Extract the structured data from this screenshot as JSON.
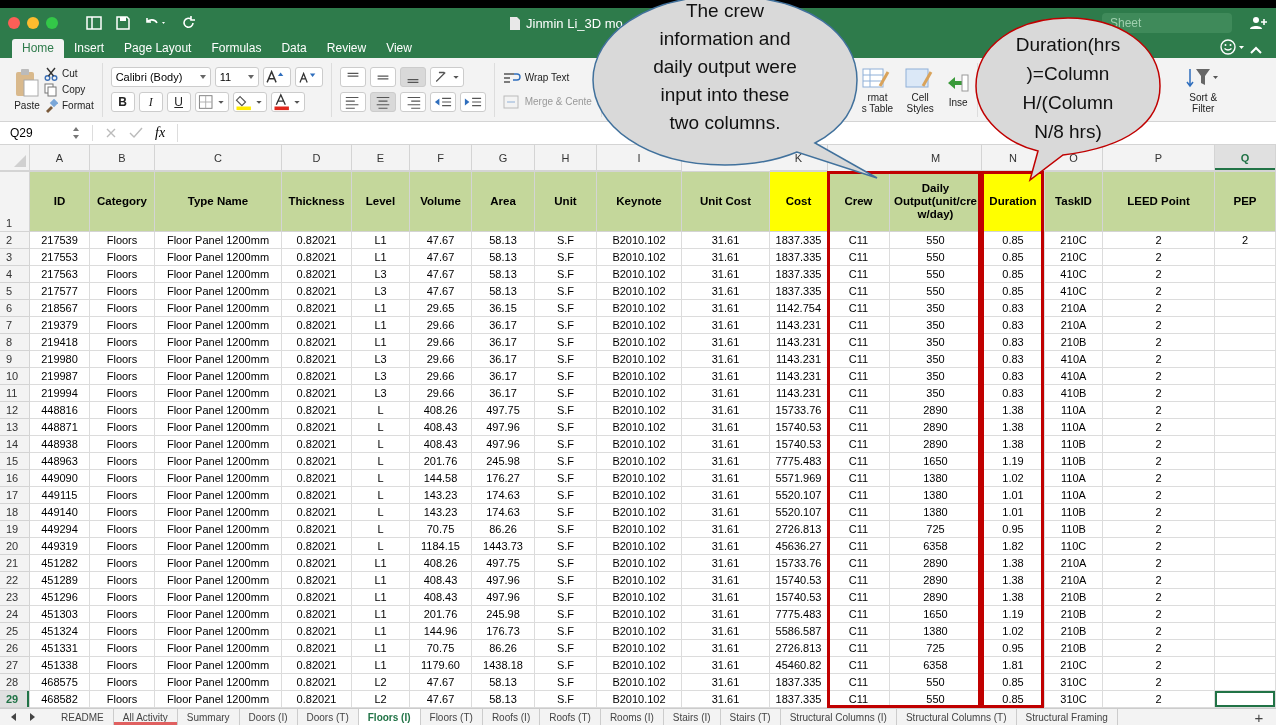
{
  "window": {
    "title": "Jinmin Li_3D mo",
    "search_placeholder": "Sheet"
  },
  "ribbon_tabs": [
    {
      "label": "Home",
      "selected": true
    },
    {
      "label": "Insert",
      "selected": false
    },
    {
      "label": "Page Layout",
      "selected": false
    },
    {
      "label": "Formulas",
      "selected": false
    },
    {
      "label": "Data",
      "selected": false
    },
    {
      "label": "Review",
      "selected": false
    },
    {
      "label": "View",
      "selected": false
    }
  ],
  "ribbon": {
    "paste": "Paste",
    "cut": "Cut",
    "copy": "Copy",
    "format": "Format",
    "font_name": "Calibri (Body)",
    "font_size": "11",
    "bold": "B",
    "italic": "I",
    "underline": "U",
    "wrap_text": "Wrap Text",
    "merge_center": "Merge & Cente",
    "format_table": "rmat\ns Table",
    "cell_styles": "Cell\nStyles",
    "insert": "Inse",
    "sort_filter": "Sort &\nFilter"
  },
  "formula_bar": {
    "name_box": "Q29",
    "fx": "fx"
  },
  "columns": [
    {
      "letter": "A",
      "header": "ID",
      "selected": false,
      "highlight": false,
      "outline_left": false,
      "outline_right": false
    },
    {
      "letter": "B",
      "header": "Category",
      "selected": false,
      "highlight": false,
      "outline_left": false,
      "outline_right": false
    },
    {
      "letter": "C",
      "header": "Type Name",
      "selected": false,
      "highlight": false,
      "outline_left": false,
      "outline_right": false
    },
    {
      "letter": "D",
      "header": "Thickness",
      "selected": false,
      "highlight": false,
      "outline_left": false,
      "outline_right": false
    },
    {
      "letter": "E",
      "header": "Level",
      "selected": false,
      "highlight": false,
      "outline_left": false,
      "outline_right": false
    },
    {
      "letter": "F",
      "header": "Volume",
      "selected": false,
      "highlight": false,
      "outline_left": false,
      "outline_right": false
    },
    {
      "letter": "G",
      "header": "Area",
      "selected": false,
      "highlight": false,
      "outline_left": false,
      "outline_right": false
    },
    {
      "letter": "H",
      "header": "Unit",
      "selected": false,
      "highlight": false,
      "outline_left": false,
      "outline_right": false
    },
    {
      "letter": "I",
      "header": "Keynote",
      "selected": false,
      "highlight": false,
      "outline_left": false,
      "outline_right": false
    },
    {
      "header": "Unit Cost",
      "selected": false,
      "highlight": false,
      "outline_left": false,
      "outline_right": false
    },
    {
      "letter": "K",
      "header": "Cost",
      "selected": false,
      "highlight": true,
      "outline_left": false,
      "outline_right": false
    },
    {
      "header": "Crew",
      "selected": false,
      "highlight": false,
      "outline_left": true,
      "outline_right": false
    },
    {
      "letter": "M",
      "header": "Daily Output(unit/crew/day)",
      "selected": false,
      "highlight": false,
      "outline_left": false,
      "outline_right": true
    },
    {
      "letter": "N",
      "header": "Duration",
      "selected": false,
      "highlight": true,
      "outline_left": true,
      "outline_right": true
    },
    {
      "letter": "O",
      "header": "TaskID",
      "selected": false,
      "highlight": false,
      "outline_left": false,
      "outline_right": false
    },
    {
      "letter": "P",
      "header": "LEED Point",
      "selected": false,
      "highlight": false,
      "outline_left": false,
      "outline_right": false
    },
    {
      "letter": "Q",
      "header": "PEP",
      "selected": true,
      "highlight": false,
      "outline_left": false,
      "outline_right": false
    }
  ],
  "header_row": {
    "number": "1"
  },
  "rows": [
    {
      "number": "2",
      "selected": false,
      "cells": [
        "217539",
        "Floors",
        "Floor Panel 1200mm",
        "0.82021",
        "L1",
        "47.67",
        "58.13",
        "S.F",
        "B2010.102",
        "31.61",
        "1837.335",
        "C11",
        "550",
        "0.85",
        "210C",
        "2",
        "2"
      ]
    },
    {
      "number": "3",
      "selected": false,
      "cells": [
        "217553",
        "Floors",
        "Floor Panel 1200mm",
        "0.82021",
        "L1",
        "47.67",
        "58.13",
        "S.F",
        "B2010.102",
        "31.61",
        "1837.335",
        "C11",
        "550",
        "0.85",
        "210C",
        "2"
      ]
    },
    {
      "number": "4",
      "selected": false,
      "cells": [
        "217563",
        "Floors",
        "Floor Panel 1200mm",
        "0.82021",
        "L3",
        "47.67",
        "58.13",
        "S.F",
        "B2010.102",
        "31.61",
        "1837.335",
        "C11",
        "550",
        "0.85",
        "410C",
        "2"
      ]
    },
    {
      "number": "5",
      "selected": false,
      "cells": [
        "217577",
        "Floors",
        "Floor Panel 1200mm",
        "0.82021",
        "L3",
        "47.67",
        "58.13",
        "S.F",
        "B2010.102",
        "31.61",
        "1837.335",
        "C11",
        "550",
        "0.85",
        "410C",
        "2"
      ]
    },
    {
      "number": "6",
      "selected": false,
      "cells": [
        "218567",
        "Floors",
        "Floor Panel 1200mm",
        "0.82021",
        "L1",
        "29.65",
        "36.15",
        "S.F",
        "B2010.102",
        "31.61",
        "1142.754",
        "C11",
        "350",
        "0.83",
        "210A",
        "2"
      ]
    },
    {
      "number": "7",
      "selected": false,
      "cells": [
        "219379",
        "Floors",
        "Floor Panel 1200mm",
        "0.82021",
        "L1",
        "29.66",
        "36.17",
        "S.F",
        "B2010.102",
        "31.61",
        "1143.231",
        "C11",
        "350",
        "0.83",
        "210A",
        "2"
      ]
    },
    {
      "number": "8",
      "selected": false,
      "cells": [
        "219418",
        "Floors",
        "Floor Panel 1200mm",
        "0.82021",
        "L1",
        "29.66",
        "36.17",
        "S.F",
        "B2010.102",
        "31.61",
        "1143.231",
        "C11",
        "350",
        "0.83",
        "210B",
        "2"
      ]
    },
    {
      "number": "9",
      "selected": false,
      "cells": [
        "219980",
        "Floors",
        "Floor Panel 1200mm",
        "0.82021",
        "L3",
        "29.66",
        "36.17",
        "S.F",
        "B2010.102",
        "31.61",
        "1143.231",
        "C11",
        "350",
        "0.83",
        "410A",
        "2"
      ]
    },
    {
      "number": "10",
      "selected": false,
      "cells": [
        "219987",
        "Floors",
        "Floor Panel 1200mm",
        "0.82021",
        "L3",
        "29.66",
        "36.17",
        "S.F",
        "B2010.102",
        "31.61",
        "1143.231",
        "C11",
        "350",
        "0.83",
        "410A",
        "2"
      ]
    },
    {
      "number": "11",
      "selected": false,
      "cells": [
        "219994",
        "Floors",
        "Floor Panel 1200mm",
        "0.82021",
        "L3",
        "29.66",
        "36.17",
        "S.F",
        "B2010.102",
        "31.61",
        "1143.231",
        "C11",
        "350",
        "0.83",
        "410B",
        "2"
      ]
    },
    {
      "number": "12",
      "selected": false,
      "cells": [
        "448816",
        "Floors",
        "Floor Panel 1200mm",
        "0.82021",
        "L",
        "408.26",
        "497.75",
        "S.F",
        "B2010.102",
        "31.61",
        "15733.76",
        "C11",
        "2890",
        "1.38",
        "110A",
        "2"
      ]
    },
    {
      "number": "13",
      "selected": false,
      "cells": [
        "448871",
        "Floors",
        "Floor Panel 1200mm",
        "0.82021",
        "L",
        "408.43",
        "497.96",
        "S.F",
        "B2010.102",
        "31.61",
        "15740.53",
        "C11",
        "2890",
        "1.38",
        "110A",
        "2"
      ]
    },
    {
      "number": "14",
      "selected": false,
      "cells": [
        "448938",
        "Floors",
        "Floor Panel 1200mm",
        "0.82021",
        "L",
        "408.43",
        "497.96",
        "S.F",
        "B2010.102",
        "31.61",
        "15740.53",
        "C11",
        "2890",
        "1.38",
        "110B",
        "2"
      ]
    },
    {
      "number": "15",
      "selected": false,
      "cells": [
        "448963",
        "Floors",
        "Floor Panel 1200mm",
        "0.82021",
        "L",
        "201.76",
        "245.98",
        "S.F",
        "B2010.102",
        "31.61",
        "7775.483",
        "C11",
        "1650",
        "1.19",
        "110B",
        "2"
      ]
    },
    {
      "number": "16",
      "selected": false,
      "cells": [
        "449090",
        "Floors",
        "Floor Panel 1200mm",
        "0.82021",
        "L",
        "144.58",
        "176.27",
        "S.F",
        "B2010.102",
        "31.61",
        "5571.969",
        "C11",
        "1380",
        "1.02",
        "110A",
        "2"
      ]
    },
    {
      "number": "17",
      "selected": false,
      "cells": [
        "449115",
        "Floors",
        "Floor Panel 1200mm",
        "0.82021",
        "L",
        "143.23",
        "174.63",
        "S.F",
        "B2010.102",
        "31.61",
        "5520.107",
        "C11",
        "1380",
        "1.01",
        "110A",
        "2"
      ]
    },
    {
      "number": "18",
      "selected": false,
      "cells": [
        "449140",
        "Floors",
        "Floor Panel 1200mm",
        "0.82021",
        "L",
        "143.23",
        "174.63",
        "S.F",
        "B2010.102",
        "31.61",
        "5520.107",
        "C11",
        "1380",
        "1.01",
        "110B",
        "2"
      ]
    },
    {
      "number": "19",
      "selected": false,
      "cells": [
        "449294",
        "Floors",
        "Floor Panel 1200mm",
        "0.82021",
        "L",
        "70.75",
        "86.26",
        "S.F",
        "B2010.102",
        "31.61",
        "2726.813",
        "C11",
        "725",
        "0.95",
        "110B",
        "2"
      ]
    },
    {
      "number": "20",
      "selected": false,
      "cells": [
        "449319",
        "Floors",
        "Floor Panel 1200mm",
        "0.82021",
        "L",
        "1184.15",
        "1443.73",
        "S.F",
        "B2010.102",
        "31.61",
        "45636.27",
        "C11",
        "6358",
        "1.82",
        "110C",
        "2"
      ]
    },
    {
      "number": "21",
      "selected": false,
      "cells": [
        "451282",
        "Floors",
        "Floor Panel 1200mm",
        "0.82021",
        "L1",
        "408.26",
        "497.75",
        "S.F",
        "B2010.102",
        "31.61",
        "15733.76",
        "C11",
        "2890",
        "1.38",
        "210A",
        "2"
      ]
    },
    {
      "number": "22",
      "selected": false,
      "cells": [
        "451289",
        "Floors",
        "Floor Panel 1200mm",
        "0.82021",
        "L1",
        "408.43",
        "497.96",
        "S.F",
        "B2010.102",
        "31.61",
        "15740.53",
        "C11",
        "2890",
        "1.38",
        "210A",
        "2"
      ]
    },
    {
      "number": "23",
      "selected": false,
      "cells": [
        "451296",
        "Floors",
        "Floor Panel 1200mm",
        "0.82021",
        "L1",
        "408.43",
        "497.96",
        "S.F",
        "B2010.102",
        "31.61",
        "15740.53",
        "C11",
        "2890",
        "1.38",
        "210B",
        "2"
      ]
    },
    {
      "number": "24",
      "selected": false,
      "cells": [
        "451303",
        "Floors",
        "Floor Panel 1200mm",
        "0.82021",
        "L1",
        "201.76",
        "245.98",
        "S.F",
        "B2010.102",
        "31.61",
        "7775.483",
        "C11",
        "1650",
        "1.19",
        "210B",
        "2"
      ]
    },
    {
      "number": "25",
      "selected": false,
      "cells": [
        "451324",
        "Floors",
        "Floor Panel 1200mm",
        "0.82021",
        "L1",
        "144.96",
        "176.73",
        "S.F",
        "B2010.102",
        "31.61",
        "5586.587",
        "C11",
        "1380",
        "1.02",
        "210B",
        "2"
      ]
    },
    {
      "number": "26",
      "selected": false,
      "cells": [
        "451331",
        "Floors",
        "Floor Panel 1200mm",
        "0.82021",
        "L1",
        "70.75",
        "86.26",
        "S.F",
        "B2010.102",
        "31.61",
        "2726.813",
        "C11",
        "725",
        "0.95",
        "210B",
        "2"
      ]
    },
    {
      "number": "27",
      "selected": false,
      "cells": [
        "451338",
        "Floors",
        "Floor Panel 1200mm",
        "0.82021",
        "L1",
        "1179.60",
        "1438.18",
        "S.F",
        "B2010.102",
        "31.61",
        "45460.82",
        "C11",
        "6358",
        "1.81",
        "210C",
        "2"
      ]
    },
    {
      "number": "28",
      "selected": false,
      "cells": [
        "468575",
        "Floors",
        "Floor Panel 1200mm",
        "0.82021",
        "L2",
        "47.67",
        "58.13",
        "S.F",
        "B2010.102",
        "31.61",
        "1837.335",
        "C11",
        "550",
        "0.85",
        "310C",
        "2"
      ]
    },
    {
      "number": "29",
      "selected": true,
      "cells": [
        "468582",
        "Floors",
        "Floor Panel 1200mm",
        "0.82021",
        "L2",
        "47.67",
        "58.13",
        "S.F",
        "B2010.102",
        "31.61",
        "1837.335",
        "C11",
        "550",
        "0.85",
        "310C",
        "2"
      ]
    }
  ],
  "callouts": [
    {
      "kind": "bubble",
      "text": "The crew information and daily output were input into these two columns."
    },
    {
      "kind": "oval",
      "text": "Duration(hrs )=Column H/(Column N/8 hrs)"
    }
  ],
  "sheet_tabs": [
    {
      "label": "README",
      "selected": false
    },
    {
      "label": "All Activity",
      "selected": false,
      "color": "#e06060"
    },
    {
      "label": "Summary",
      "selected": false
    },
    {
      "label": "Doors (I)",
      "selected": false
    },
    {
      "label": "Doors (T)",
      "selected": false
    },
    {
      "label": "Floors (I)",
      "selected": true
    },
    {
      "label": "Floors (T)",
      "selected": false
    },
    {
      "label": "Roofs (I)",
      "selected": false
    },
    {
      "label": "Roofs (T)",
      "selected": false
    },
    {
      "label": "Rooms (I)",
      "selected": false
    },
    {
      "label": "Stairs (I)",
      "selected": false
    },
    {
      "label": "Stairs (T)",
      "selected": false
    },
    {
      "label": "Structural Columns (I)",
      "selected": false
    },
    {
      "label": "Structural Columns (T)",
      "selected": false
    },
    {
      "label": "Structural Framing",
      "selected": false
    }
  ],
  "add_sheet": "+"
}
